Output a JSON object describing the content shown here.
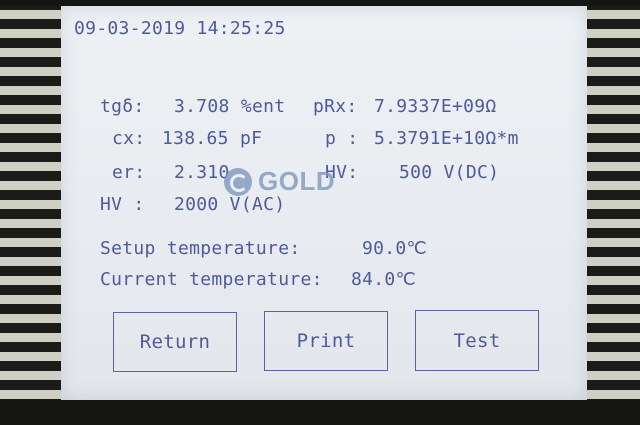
{
  "status": {
    "datetime": "09-03-2019 14:25:25"
  },
  "readings": {
    "tg_label": "tgδ:",
    "tg_value": "3.708 %ent",
    "prx_label": "pRx:",
    "prx_value": "7.9337E+09Ω",
    "cx_label": "cx:",
    "cx_value": "138.65 pF",
    "p_label": "p :",
    "p_value": "5.3791E+10Ω*m",
    "er_label": "er:",
    "er_value": "2.310",
    "hv_dc_label": "HV:",
    "hv_dc_value": "500 V(DC)",
    "hv_ac_label": "HV :",
    "hv_ac_value": "2000 V(AC)"
  },
  "temperature": {
    "setup_label": "Setup temperature:",
    "setup_value": "90.0℃",
    "current_label": "Current temperature:",
    "current_value": "84.0℃"
  },
  "buttons": {
    "return_label": "Return",
    "print_label": "Print",
    "test_label": "Test"
  },
  "watermark": {
    "text": "GOLD",
    "color": "#7f97bf"
  },
  "colors": {
    "text": "#4e5a9c",
    "screen_bg": "#eef1f4",
    "bezel": "#1b1b18"
  }
}
